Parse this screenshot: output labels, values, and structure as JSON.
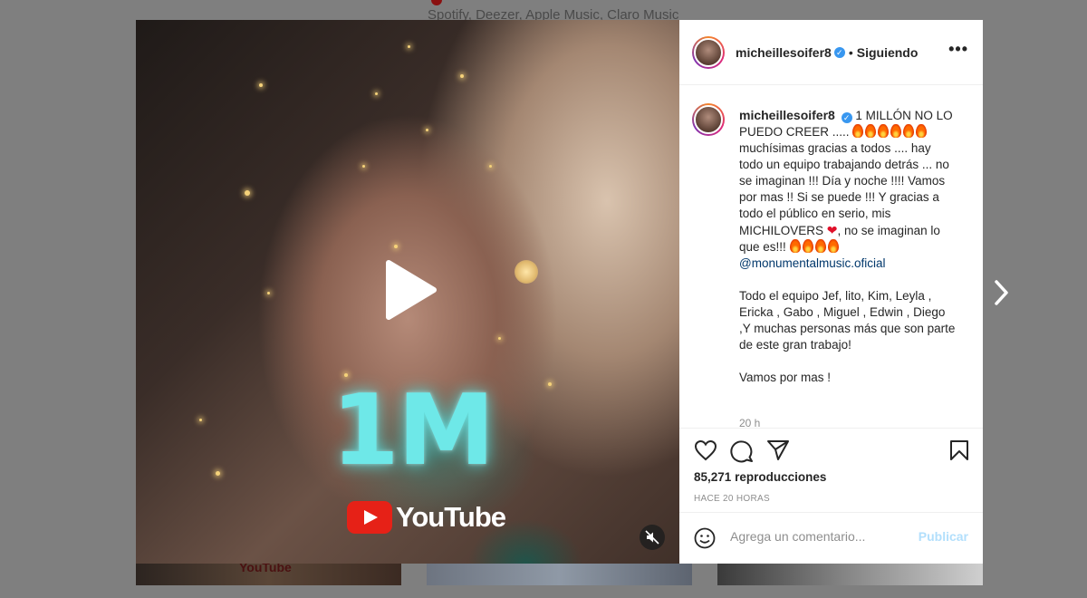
{
  "background": {
    "top_text": "Spotify, Deezer, Apple Music, Claro Music",
    "thumb_text": "YouTube"
  },
  "media": {
    "overlay_big_text": "1M",
    "overlay_brand_text": "YouTube",
    "play_icon": "play-icon",
    "mute_icon": "muted-speaker-icon"
  },
  "post": {
    "username": "micheillesoifer8",
    "verified_icon": "verified-badge-icon",
    "separator": "•",
    "follow_status": "Siguiendo",
    "more_icon": "more-options-icon",
    "more_label": "•••"
  },
  "caption": {
    "line1_text": "1 MILLÓN NO LO PUEDO CREER .....",
    "line2_text": "muchísimas gracias a todos .... hay todo un equipo trabajando detrás ... no se imaginan !!! Día y noche !!!! Vamos por mas !! Si se puede !!! Y gracias a todo el público en serio, mis MICHILOVERS",
    "line3_text": ", no se imaginan lo que es!!!",
    "mention": "@monumentalmusic.oficial",
    "para2": "Todo el equipo Jef, lito, Kim, Leyla , Ericka , Gabo , Miguel , Edwin , Diego ,Y muchas personas más que son parte de este gran trabajo!",
    "para3": "Vamos por mas !",
    "time": "20 h"
  },
  "actions": {
    "like_icon": "heart-icon",
    "comment_icon": "comment-icon",
    "share_icon": "share-icon",
    "save_icon": "bookmark-icon",
    "views_count": "85,271",
    "views_label": "reproducciones",
    "posted_ago": "HACE 20 HORAS"
  },
  "comment": {
    "emoji_icon": "smiley-icon",
    "placeholder": "Agrega un comentario...",
    "publish_label": "Publicar"
  },
  "nav": {
    "next_icon": "chevron-right-icon"
  }
}
